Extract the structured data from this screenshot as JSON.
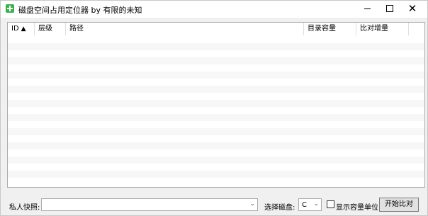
{
  "window": {
    "title": "磁盘空间占用定位器  by 有限的未知"
  },
  "titlebar_buttons": {
    "minimize": "minimize-icon",
    "maximize": "maximize-icon",
    "close": "close-icon",
    "close_glyph": "✕"
  },
  "table": {
    "columns": [
      {
        "label": "ID"
      },
      {
        "label": "层级"
      },
      {
        "label": "路径"
      },
      {
        "label": "目录容量"
      },
      {
        "label": "比对增量"
      }
    ],
    "sort_indicator": "▲",
    "rows": []
  },
  "bottom": {
    "snapshot_label": "私人快照:",
    "snapshot_value": "",
    "disk_label": "选择磁盘:",
    "disk_value": "C",
    "show_unit_label": "显示容量单位",
    "show_unit_checked": false,
    "compare_button": "开始比对"
  },
  "colors": {
    "accent": "#3ab24a",
    "stripe": "#f7f7f7"
  }
}
